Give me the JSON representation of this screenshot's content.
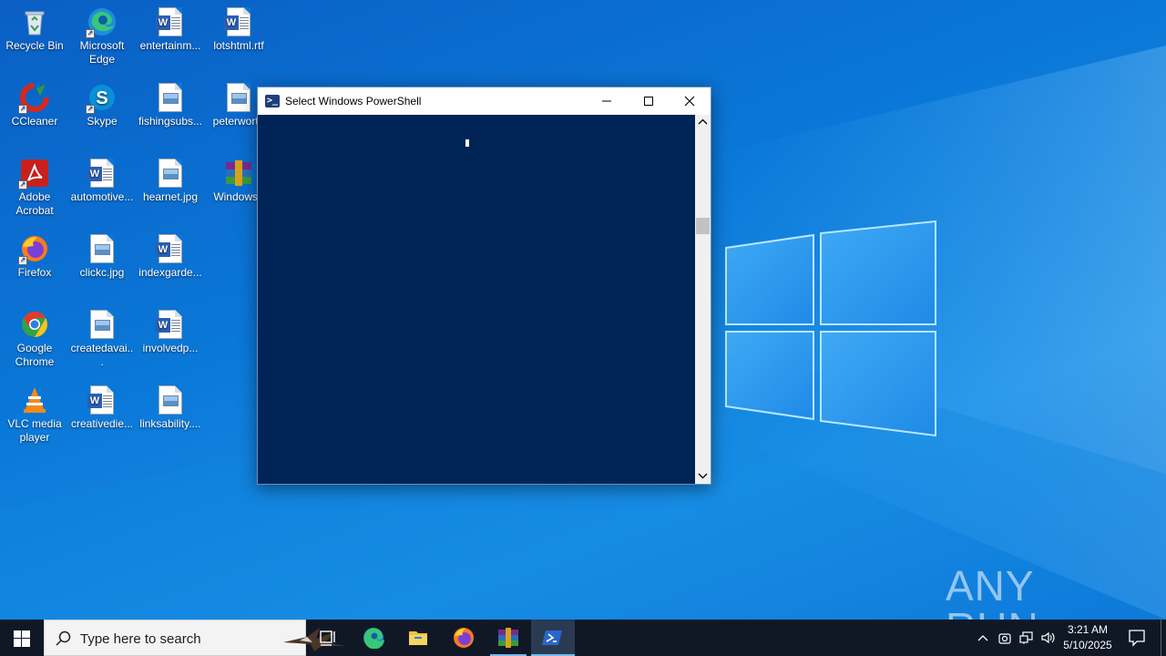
{
  "desktop": {
    "icons": [
      {
        "label": "Recycle Bin",
        "icon": "recycle-bin-icon"
      },
      {
        "label": "Microsoft Edge",
        "icon": "edge-icon"
      },
      {
        "label": "entertainm...",
        "icon": "word-document-icon"
      },
      {
        "label": "lotshtml.rtf",
        "icon": "word-document-icon"
      },
      {
        "label": "CCleaner",
        "icon": "ccleaner-icon"
      },
      {
        "label": "Skype",
        "icon": "skype-icon"
      },
      {
        "label": "fishingsubs...",
        "icon": "image-file-icon"
      },
      {
        "label": "peterworth",
        "icon": "image-file-icon"
      },
      {
        "label": "Adobe Acrobat",
        "icon": "acrobat-icon"
      },
      {
        "label": "automotive...",
        "icon": "word-document-icon"
      },
      {
        "label": "hearnet.jpg",
        "icon": "image-file-icon"
      },
      {
        "label": "WindowsL",
        "icon": "winrar-icon"
      },
      {
        "label": "Firefox",
        "icon": "firefox-icon"
      },
      {
        "label": "clickc.jpg",
        "icon": "image-file-icon"
      },
      {
        "label": "indexgarde...",
        "icon": "word-document-icon"
      },
      {
        "label": "Google Chrome",
        "icon": "chrome-icon"
      },
      {
        "label": "createdavai...",
        "icon": "image-file-icon"
      },
      {
        "label": "involvedp...",
        "icon": "word-document-icon"
      },
      {
        "label": "VLC media player",
        "icon": "vlc-icon"
      },
      {
        "label": "creativedie...",
        "icon": "word-document-icon"
      },
      {
        "label": "linksability....",
        "icon": "image-file-icon"
      }
    ]
  },
  "window": {
    "title": "Select Windows PowerShell",
    "console_background": "#012456",
    "minimize_icon": "minimize-icon",
    "maximize_icon": "maximize-icon",
    "close_icon": "close-icon"
  },
  "watermark": {
    "text": "ANY RUN"
  },
  "taskbar": {
    "search_placeholder": "Type here to search",
    "pinned": [
      "task-view-icon",
      "edge-icon",
      "file-explorer-icon",
      "firefox-icon",
      "winrar-icon",
      "powershell-icon"
    ],
    "clock_time": "3:21 AM",
    "clock_date": "5/10/2025",
    "accent": "#76b9ed"
  }
}
